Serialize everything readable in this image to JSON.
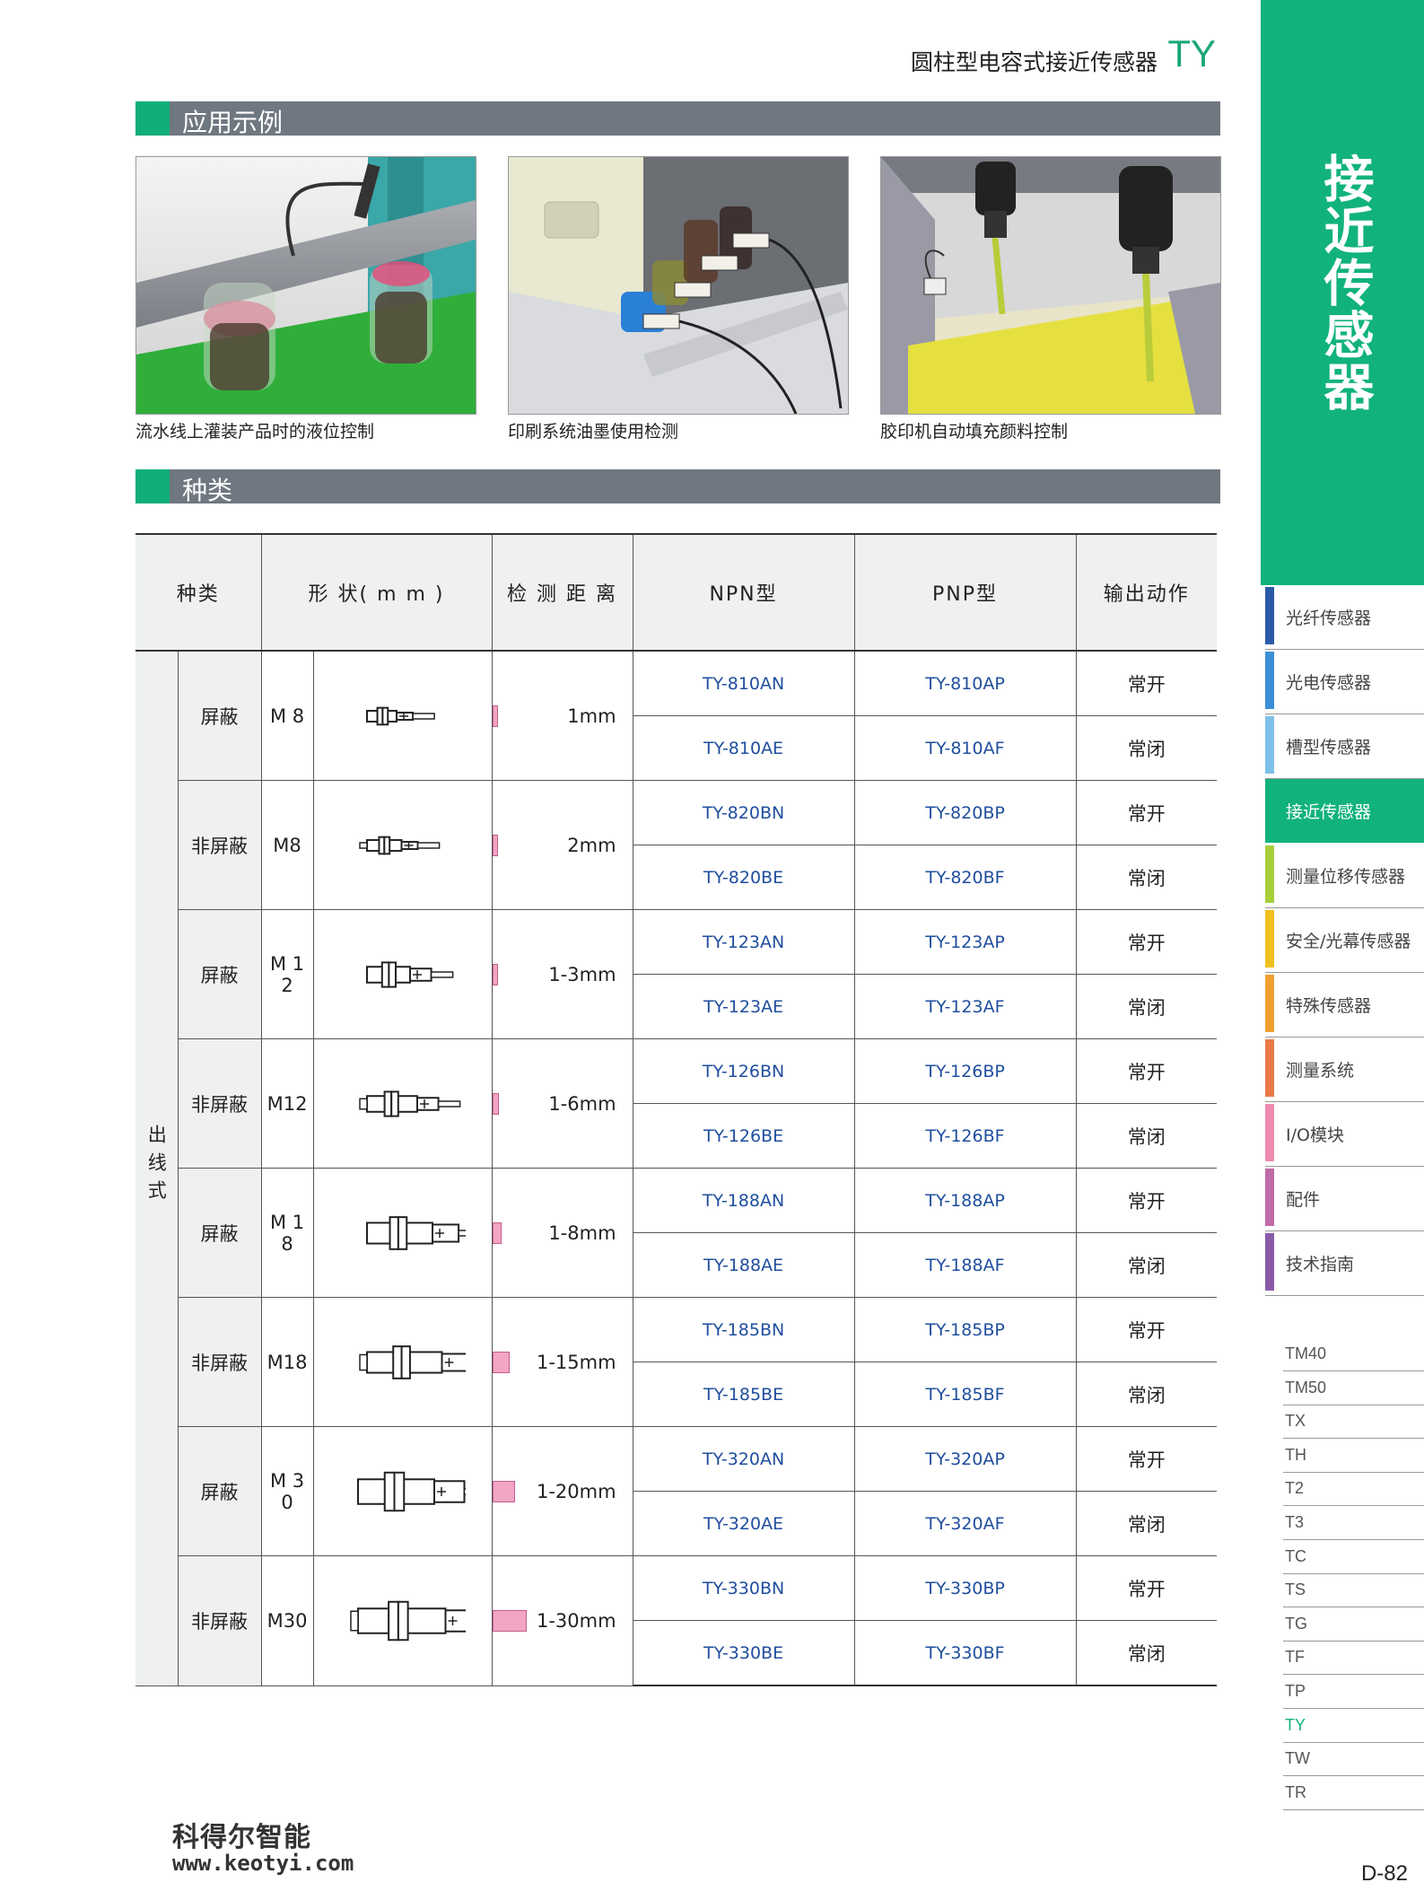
{
  "header": {
    "title": "圆柱型电容式接近传感器",
    "model": "TY"
  },
  "sections": {
    "applications": "应用示例",
    "types": "种类"
  },
  "applications": [
    {
      "caption": "流水线上灌装产品时的液位控制"
    },
    {
      "caption": "印刷系统油墨使用检测"
    },
    {
      "caption": "胶印机自动填充颜料控制"
    }
  ],
  "table": {
    "headers": [
      "种类",
      "形 状( m m )",
      "检 测 距 离",
      "NPN型",
      "PNP型",
      "输出动作"
    ],
    "group_label": "出线式",
    "rows": [
      {
        "shield": "屏蔽",
        "size": "M 8",
        "distance": "1mm",
        "dist_value": 1,
        "items": [
          {
            "npn": "TY-810AN",
            "pnp": "TY-810AP",
            "out": "常开"
          },
          {
            "npn": "TY-810AE",
            "pnp": "TY-810AF",
            "out": "常闭"
          }
        ]
      },
      {
        "shield": "非屏蔽",
        "size": "M8",
        "distance": "2mm",
        "dist_value": 2,
        "items": [
          {
            "npn": "TY-820BN",
            "pnp": "TY-820BP",
            "out": "常开"
          },
          {
            "npn": "TY-820BE",
            "pnp": "TY-820BF",
            "out": "常闭"
          }
        ]
      },
      {
        "shield": "屏蔽",
        "size": "M 1 2",
        "distance": "1-3mm",
        "dist_value": 3,
        "items": [
          {
            "npn": "TY-123AN",
            "pnp": "TY-123AP",
            "out": "常开"
          },
          {
            "npn": "TY-123AE",
            "pnp": "TY-123AF",
            "out": "常闭"
          }
        ]
      },
      {
        "shield": "非屏蔽",
        "size": "M12",
        "distance": "1-6mm",
        "dist_value": 6,
        "items": [
          {
            "npn": "TY-126BN",
            "pnp": "TY-126BP",
            "out": "常开"
          },
          {
            "npn": "TY-126BE",
            "pnp": "TY-126BF",
            "out": "常闭"
          }
        ]
      },
      {
        "shield": "屏蔽",
        "size": "M 1 8",
        "distance": "1-8mm",
        "dist_value": 8,
        "items": [
          {
            "npn": "TY-188AN",
            "pnp": "TY-188AP",
            "out": "常开"
          },
          {
            "npn": "TY-188AE",
            "pnp": "TY-188AF",
            "out": "常闭"
          }
        ]
      },
      {
        "shield": "非屏蔽",
        "size": "M18",
        "distance": "1-15mm",
        "dist_value": 15,
        "items": [
          {
            "npn": "TY-185BN",
            "pnp": "TY-185BP",
            "out": "常开"
          },
          {
            "npn": "TY-185BE",
            "pnp": "TY-185BF",
            "out": "常闭"
          }
        ]
      },
      {
        "shield": "屏蔽",
        "size": "M 3 0",
        "distance": "1-20mm",
        "dist_value": 20,
        "items": [
          {
            "npn": "TY-320AN",
            "pnp": "TY-320AP",
            "out": "常开"
          },
          {
            "npn": "TY-320AE",
            "pnp": "TY-320AF",
            "out": "常闭"
          }
        ]
      },
      {
        "shield": "非屏蔽",
        "size": "M30",
        "distance": "1-30mm",
        "dist_value": 30,
        "items": [
          {
            "npn": "TY-330BN",
            "pnp": "TY-330BP",
            "out": "常开"
          },
          {
            "npn": "TY-330BE",
            "pnp": "TY-330BF",
            "out": "常闭"
          }
        ]
      }
    ]
  },
  "sidebar": {
    "title": "接近传感器",
    "nav": [
      {
        "label": "光纤传感器",
        "color": "#2d5aa8"
      },
      {
        "label": "光电传感器",
        "color": "#3b8fd6"
      },
      {
        "label": "槽型传感器",
        "color": "#7ec0e8"
      },
      {
        "label": "接近传感器",
        "color": "#12b27c",
        "active": true
      },
      {
        "label": "测量位移传感器",
        "color": "#a8cf3a"
      },
      {
        "label": "安全/光幕传感器",
        "color": "#f0c020"
      },
      {
        "label": "特殊传感器",
        "color": "#f0a030"
      },
      {
        "label": "测量系统",
        "color": "#ea7a4a"
      },
      {
        "label": "I/O模块",
        "color": "#ef8ab0"
      },
      {
        "label": "配件",
        "color": "#c06aa8"
      },
      {
        "label": "技术指南",
        "color": "#8a5aa8"
      }
    ],
    "subs": [
      "TM40",
      "TM50",
      "TX",
      "TH",
      "T2",
      "T3",
      "TC",
      "TS",
      "TG",
      "TF",
      "TP",
      "TY",
      "TW",
      "TR"
    ],
    "current_sub": "TY"
  },
  "footer": {
    "page": "D-82",
    "brand": "科得尔智能",
    "url": "www.keotyi.com"
  }
}
